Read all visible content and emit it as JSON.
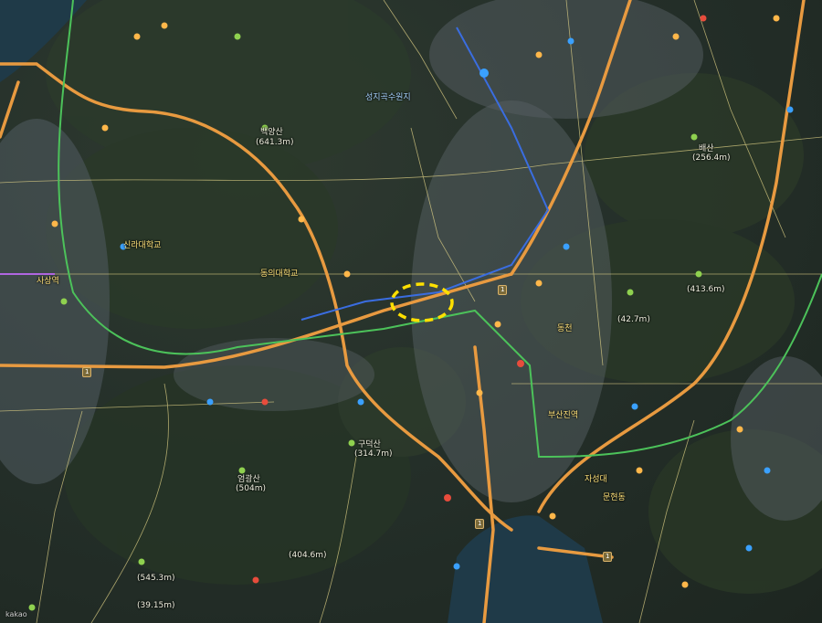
{
  "map": {
    "attribution": "kakao",
    "colors": {
      "road_major": "#e89a40",
      "road_minor": "#e8d98a",
      "subway_green": "#4cc25a",
      "subway_blue": "#3a6de0",
      "water": "#1f3a48",
      "highlight": "#ffe000"
    },
    "highlight_marker": {
      "shape": "dashed-ellipse",
      "color": "yellow"
    },
    "labels": [
      {
        "id": "l1",
        "text": "백양산"
      },
      {
        "id": "l2",
        "text": "(641.3m)"
      },
      {
        "id": "l3",
        "text": "배산"
      },
      {
        "id": "l4",
        "text": "(256.4m)"
      },
      {
        "id": "l5",
        "text": "(413.6m)"
      },
      {
        "id": "l6",
        "text": "구덕산"
      },
      {
        "id": "l7",
        "text": "(314.7m)"
      },
      {
        "id": "l8",
        "text": "엄광산"
      },
      {
        "id": "l9",
        "text": "(504m)"
      },
      {
        "id": "l10",
        "text": "(404.6m)"
      },
      {
        "id": "l11",
        "text": "(545.3m)"
      },
      {
        "id": "l12",
        "text": "(39.15m)"
      },
      {
        "id": "l13",
        "text": "(42.7m)"
      },
      {
        "id": "l14",
        "text": "성지곡수원지"
      },
      {
        "id": "l15",
        "text": "사상역"
      },
      {
        "id": "l16",
        "text": "신라대학교"
      },
      {
        "id": "l17",
        "text": "동의대학교"
      },
      {
        "id": "l18",
        "text": "부산진역"
      },
      {
        "id": "l19",
        "text": "자성대"
      },
      {
        "id": "l20",
        "text": "동천"
      },
      {
        "id": "l21",
        "text": "문현동"
      },
      {
        "id": "l22",
        "text": "kakao"
      }
    ],
    "route_shields": [
      "1",
      "1",
      "1",
      "1"
    ]
  }
}
